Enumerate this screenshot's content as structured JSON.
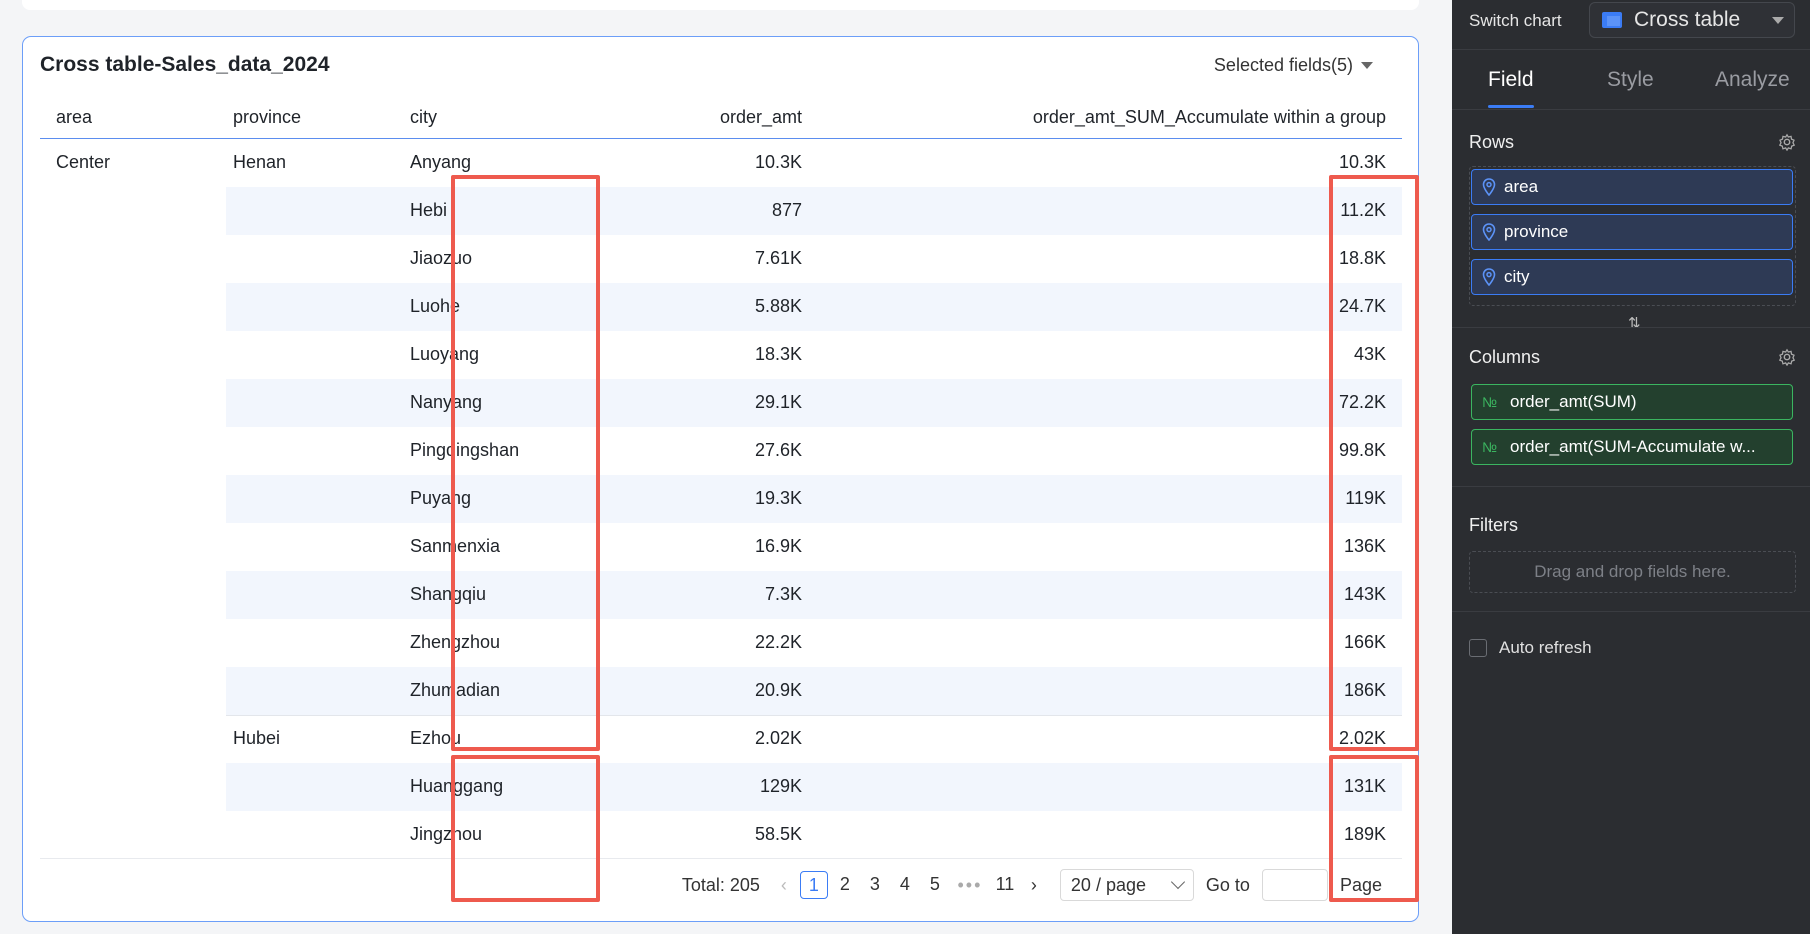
{
  "table_card": {
    "title": "Cross table-Sales_data_2024",
    "selected_fields": "Selected fields(5)"
  },
  "columns": [
    "area",
    "province",
    "city",
    "order_amt",
    "order_amt_SUM_Accumulate within a group"
  ],
  "rows": [
    {
      "area": "Center",
      "province": "Henan",
      "city": "Anyang",
      "order_amt": "10.3K",
      "accumulate": "10.3K"
    },
    {
      "area": "",
      "province": "",
      "city": "Hebi",
      "order_amt": "877",
      "accumulate": "11.2K"
    },
    {
      "area": "",
      "province": "",
      "city": "Jiaozuo",
      "order_amt": "7.61K",
      "accumulate": "18.8K"
    },
    {
      "area": "",
      "province": "",
      "city": "Luohe",
      "order_amt": "5.88K",
      "accumulate": "24.7K"
    },
    {
      "area": "",
      "province": "",
      "city": "Luoyang",
      "order_amt": "18.3K",
      "accumulate": "43K"
    },
    {
      "area": "",
      "province": "",
      "city": "Nanyang",
      "order_amt": "29.1K",
      "accumulate": "72.2K"
    },
    {
      "area": "",
      "province": "",
      "city": "Pingdingshan",
      "order_amt": "27.6K",
      "accumulate": "99.8K"
    },
    {
      "area": "",
      "province": "",
      "city": "Puyang",
      "order_amt": "19.3K",
      "accumulate": "119K"
    },
    {
      "area": "",
      "province": "",
      "city": "Sanmenxia",
      "order_amt": "16.9K",
      "accumulate": "136K"
    },
    {
      "area": "",
      "province": "",
      "city": "Shangqiu",
      "order_amt": "7.3K",
      "accumulate": "143K"
    },
    {
      "area": "",
      "province": "",
      "city": "Zhengzhou",
      "order_amt": "22.2K",
      "accumulate": "166K"
    },
    {
      "area": "",
      "province": "",
      "city": "Zhumadian",
      "order_amt": "20.9K",
      "accumulate": "186K"
    },
    {
      "area": "",
      "province": "Hubei",
      "city": "Ezhou",
      "order_amt": "2.02K",
      "accumulate": "2.02K"
    },
    {
      "area": "",
      "province": "",
      "city": "Huanggang",
      "order_amt": "129K",
      "accumulate": "131K"
    },
    {
      "area": "",
      "province": "",
      "city": "Jingzhou",
      "order_amt": "58.5K",
      "accumulate": "189K"
    }
  ],
  "pagination": {
    "total": "Total: 205",
    "pages": [
      "1",
      "2",
      "3",
      "4",
      "5"
    ],
    "dots": "•••",
    "last": "11",
    "page_size": "20 / page",
    "goto": "Go to",
    "page_suffix": "Page"
  },
  "panel": {
    "switch_chart_label": "Switch chart",
    "chart_type": "Cross table",
    "tabs": [
      "Field",
      "Style",
      "Analyze"
    ],
    "rows_title": "Rows",
    "row_fields": [
      "area",
      "province",
      "city"
    ],
    "columns_title": "Columns",
    "column_fields": [
      "order_amt(SUM)",
      "order_amt(SUM-Accumulate w..."
    ],
    "measure_prefix": "№",
    "filters_title": "Filters",
    "filters_placeholder": "Drag and drop fields here.",
    "auto_refresh": "Auto refresh",
    "swap_glyph": "⇅"
  },
  "colors": {
    "highlight": "#ee5a4e",
    "accent": "#3b7cf5",
    "measure": "#3bb560"
  }
}
